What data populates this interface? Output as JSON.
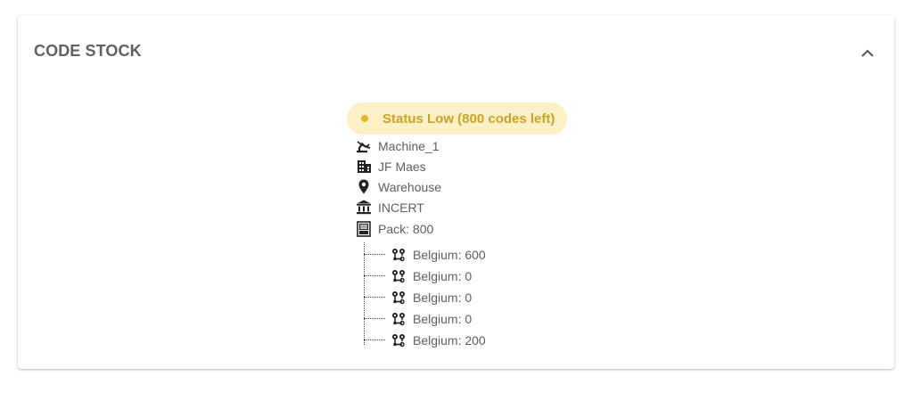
{
  "card": {
    "title": "CODE STOCK"
  },
  "status": {
    "label": "Status Low (800 codes left)",
    "color": "#e6b71d",
    "background": "#fbf0c6"
  },
  "info": {
    "machine": {
      "icon": "robot-arm-icon",
      "label": "Machine_1"
    },
    "company": {
      "icon": "building-icon",
      "label": "JF Maes"
    },
    "location": {
      "icon": "location-pin-icon",
      "label": "Warehouse"
    },
    "authority": {
      "icon": "bank-icon",
      "label": "INCERT"
    },
    "pack": {
      "icon": "pack-icon",
      "label": "Pack: 800"
    }
  },
  "markets": [
    {
      "icon": "route-icon",
      "label": "Belgium: 600"
    },
    {
      "icon": "route-icon",
      "label": "Belgium: 0"
    },
    {
      "icon": "route-icon",
      "label": "Belgium: 0"
    },
    {
      "icon": "route-icon",
      "label": "Belgium: 0"
    },
    {
      "icon": "route-icon",
      "label": "Belgium: 200"
    }
  ]
}
